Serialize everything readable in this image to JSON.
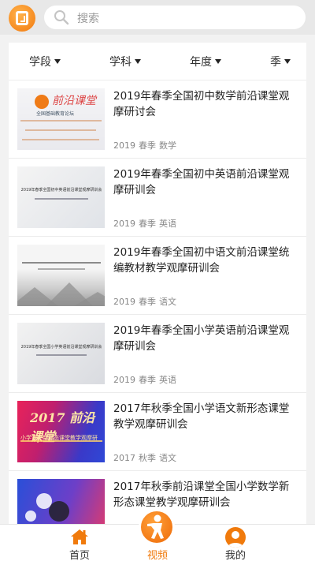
{
  "search": {
    "placeholder": "搜索"
  },
  "filters": [
    {
      "label": "学段"
    },
    {
      "label": "学科"
    },
    {
      "label": "年度"
    },
    {
      "label": "季"
    }
  ],
  "items": [
    {
      "title": "2019年春季全国初中数学前沿课堂观摩研讨会",
      "year": "2019",
      "season": "春季",
      "subject": "数学",
      "thumb_caption": "全国基础教育论坛"
    },
    {
      "title": "2019年春季全国初中英语前沿课堂观摩研训会",
      "year": "2019",
      "season": "春季",
      "subject": "英语",
      "thumb_caption": "2019年春季全国初中英语前沿课堂观摩研训会"
    },
    {
      "title": "2019年春季全国初中语文前沿课堂统编教材教学观摩研训会",
      "year": "2019",
      "season": "春季",
      "subject": "语文",
      "thumb_caption": ""
    },
    {
      "title": "2019年春季全国小学英语前沿课堂观摩研训会",
      "year": "2019",
      "season": "春季",
      "subject": "英语",
      "thumb_caption": "2019年春季全国小学英语前沿课堂观摩研训会"
    },
    {
      "title": "2017年秋季全国小学语文新形态课堂教学观摩研训会",
      "year": "2017",
      "season": "秋季",
      "subject": "语文",
      "thumb_caption": "小学语文新形态课堂教学观摩研"
    },
    {
      "title": "2017年秋季前沿课堂全国小学数学新形态课堂教学观摩研训会",
      "year": "",
      "season": "",
      "subject": "",
      "thumb_caption": ""
    }
  ],
  "thumb_brands": {
    "brand_1": "前沿课堂",
    "brand_5": "2017 前沿课堂"
  },
  "nav": {
    "home": "首页",
    "video": "视频",
    "mine": "我的"
  },
  "colors": {
    "accent": "#f07a0c",
    "background": "#f2f2f2"
  }
}
